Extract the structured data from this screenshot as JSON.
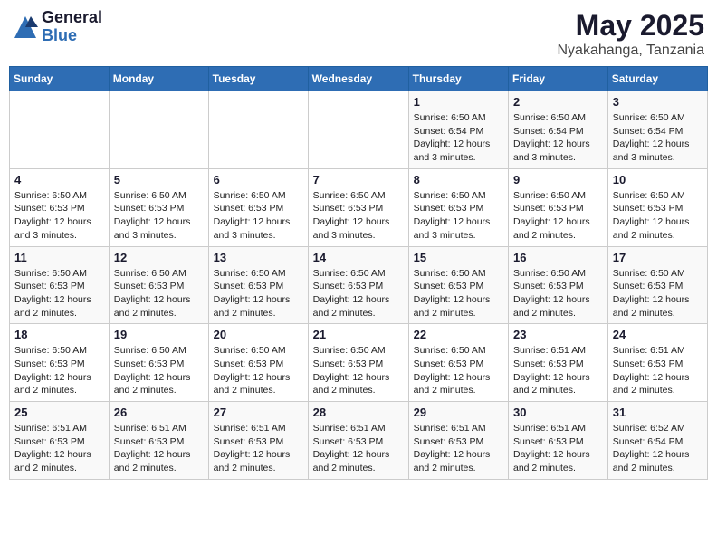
{
  "header": {
    "logo_general": "General",
    "logo_blue": "Blue",
    "month_title": "May 2025",
    "location": "Nyakahanga, Tanzania"
  },
  "calendar": {
    "days_of_week": [
      "Sunday",
      "Monday",
      "Tuesday",
      "Wednesday",
      "Thursday",
      "Friday",
      "Saturday"
    ],
    "weeks": [
      [
        {
          "day": "",
          "info": ""
        },
        {
          "day": "",
          "info": ""
        },
        {
          "day": "",
          "info": ""
        },
        {
          "day": "",
          "info": ""
        },
        {
          "day": "1",
          "info": "Sunrise: 6:50 AM\nSunset: 6:54 PM\nDaylight: 12 hours\nand 3 minutes."
        },
        {
          "day": "2",
          "info": "Sunrise: 6:50 AM\nSunset: 6:54 PM\nDaylight: 12 hours\nand 3 minutes."
        },
        {
          "day": "3",
          "info": "Sunrise: 6:50 AM\nSunset: 6:54 PM\nDaylight: 12 hours\nand 3 minutes."
        }
      ],
      [
        {
          "day": "4",
          "info": "Sunrise: 6:50 AM\nSunset: 6:53 PM\nDaylight: 12 hours\nand 3 minutes."
        },
        {
          "day": "5",
          "info": "Sunrise: 6:50 AM\nSunset: 6:53 PM\nDaylight: 12 hours\nand 3 minutes."
        },
        {
          "day": "6",
          "info": "Sunrise: 6:50 AM\nSunset: 6:53 PM\nDaylight: 12 hours\nand 3 minutes."
        },
        {
          "day": "7",
          "info": "Sunrise: 6:50 AM\nSunset: 6:53 PM\nDaylight: 12 hours\nand 3 minutes."
        },
        {
          "day": "8",
          "info": "Sunrise: 6:50 AM\nSunset: 6:53 PM\nDaylight: 12 hours\nand 3 minutes."
        },
        {
          "day": "9",
          "info": "Sunrise: 6:50 AM\nSunset: 6:53 PM\nDaylight: 12 hours\nand 2 minutes."
        },
        {
          "day": "10",
          "info": "Sunrise: 6:50 AM\nSunset: 6:53 PM\nDaylight: 12 hours\nand 2 minutes."
        }
      ],
      [
        {
          "day": "11",
          "info": "Sunrise: 6:50 AM\nSunset: 6:53 PM\nDaylight: 12 hours\nand 2 minutes."
        },
        {
          "day": "12",
          "info": "Sunrise: 6:50 AM\nSunset: 6:53 PM\nDaylight: 12 hours\nand 2 minutes."
        },
        {
          "day": "13",
          "info": "Sunrise: 6:50 AM\nSunset: 6:53 PM\nDaylight: 12 hours\nand 2 minutes."
        },
        {
          "day": "14",
          "info": "Sunrise: 6:50 AM\nSunset: 6:53 PM\nDaylight: 12 hours\nand 2 minutes."
        },
        {
          "day": "15",
          "info": "Sunrise: 6:50 AM\nSunset: 6:53 PM\nDaylight: 12 hours\nand 2 minutes."
        },
        {
          "day": "16",
          "info": "Sunrise: 6:50 AM\nSunset: 6:53 PM\nDaylight: 12 hours\nand 2 minutes."
        },
        {
          "day": "17",
          "info": "Sunrise: 6:50 AM\nSunset: 6:53 PM\nDaylight: 12 hours\nand 2 minutes."
        }
      ],
      [
        {
          "day": "18",
          "info": "Sunrise: 6:50 AM\nSunset: 6:53 PM\nDaylight: 12 hours\nand 2 minutes."
        },
        {
          "day": "19",
          "info": "Sunrise: 6:50 AM\nSunset: 6:53 PM\nDaylight: 12 hours\nand 2 minutes."
        },
        {
          "day": "20",
          "info": "Sunrise: 6:50 AM\nSunset: 6:53 PM\nDaylight: 12 hours\nand 2 minutes."
        },
        {
          "day": "21",
          "info": "Sunrise: 6:50 AM\nSunset: 6:53 PM\nDaylight: 12 hours\nand 2 minutes."
        },
        {
          "day": "22",
          "info": "Sunrise: 6:50 AM\nSunset: 6:53 PM\nDaylight: 12 hours\nand 2 minutes."
        },
        {
          "day": "23",
          "info": "Sunrise: 6:51 AM\nSunset: 6:53 PM\nDaylight: 12 hours\nand 2 minutes."
        },
        {
          "day": "24",
          "info": "Sunrise: 6:51 AM\nSunset: 6:53 PM\nDaylight: 12 hours\nand 2 minutes."
        }
      ],
      [
        {
          "day": "25",
          "info": "Sunrise: 6:51 AM\nSunset: 6:53 PM\nDaylight: 12 hours\nand 2 minutes."
        },
        {
          "day": "26",
          "info": "Sunrise: 6:51 AM\nSunset: 6:53 PM\nDaylight: 12 hours\nand 2 minutes."
        },
        {
          "day": "27",
          "info": "Sunrise: 6:51 AM\nSunset: 6:53 PM\nDaylight: 12 hours\nand 2 minutes."
        },
        {
          "day": "28",
          "info": "Sunrise: 6:51 AM\nSunset: 6:53 PM\nDaylight: 12 hours\nand 2 minutes."
        },
        {
          "day": "29",
          "info": "Sunrise: 6:51 AM\nSunset: 6:53 PM\nDaylight: 12 hours\nand 2 minutes."
        },
        {
          "day": "30",
          "info": "Sunrise: 6:51 AM\nSunset: 6:53 PM\nDaylight: 12 hours\nand 2 minutes."
        },
        {
          "day": "31",
          "info": "Sunrise: 6:52 AM\nSunset: 6:54 PM\nDaylight: 12 hours\nand 2 minutes."
        }
      ]
    ]
  }
}
